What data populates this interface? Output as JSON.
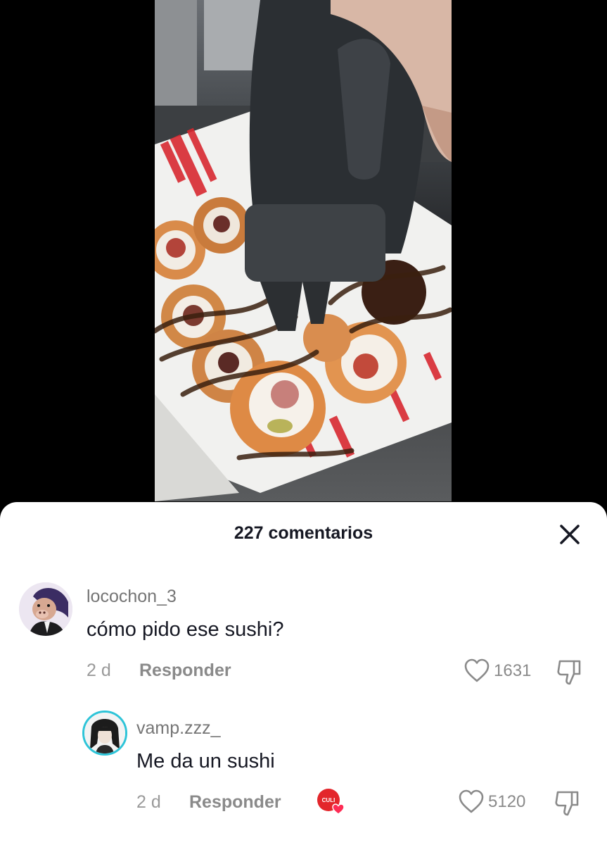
{
  "sheet": {
    "title": "227 comentarios"
  },
  "icons": {
    "close": "close-icon",
    "like": "heart-outline-icon",
    "dislike": "thumbs-down-outline-icon"
  },
  "comments": [
    {
      "username": "locochon_3",
      "text": "cómo pido ese sushi?",
      "time": "2 d",
      "reply_label": "Responder",
      "likes": "1631"
    },
    {
      "username": "vamp.zzz_",
      "text": "Me da un sushi",
      "time": "2 d",
      "reply_label": "Responder",
      "likes": "5120",
      "creator_liked_badge": "CULI"
    }
  ],
  "colors": {
    "text_primary": "#161823",
    "text_secondary": "#8a8a8a",
    "badge_red": "#e3262b",
    "heart_pink": "#fe2c55",
    "story_ring": "#2ec4d8"
  }
}
